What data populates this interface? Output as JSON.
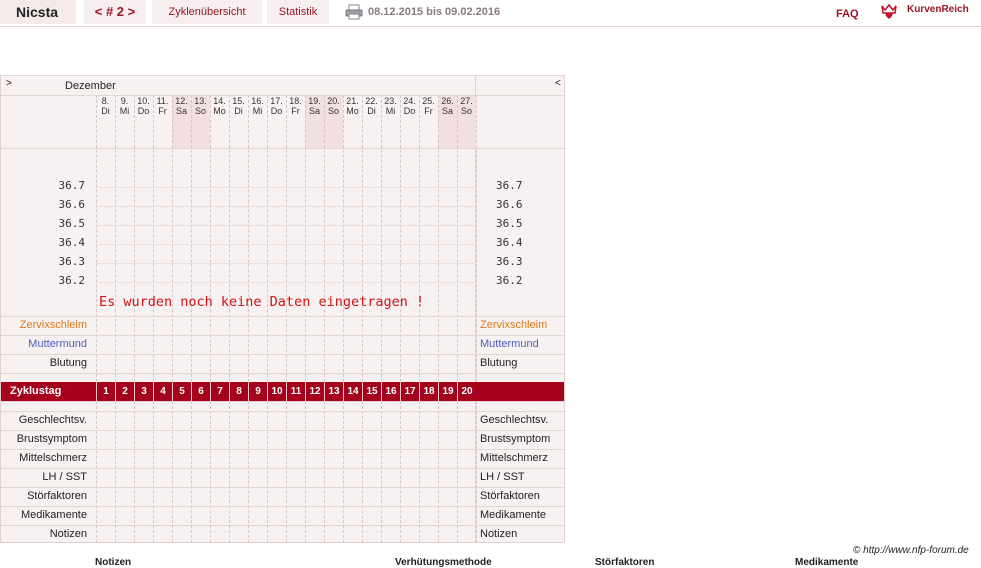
{
  "topbar": {
    "user": "Nicsta",
    "nav": "< # 2 >",
    "zyklen": "Zyklenübersicht",
    "statistik": "Statistik",
    "print_icon": "printer-icon",
    "range": "08.12.2015 bis 09.02.2016",
    "faq": "FAQ",
    "logo_icon": "crown-heart-icon",
    "brand": "KurvenReich"
  },
  "chart": {
    "prev": ">",
    "next": "<",
    "month": "Dezember",
    "days": [
      {
        "n": "8.",
        "d": "Di"
      },
      {
        "n": "9.",
        "d": "Mi"
      },
      {
        "n": "10.",
        "d": "Do"
      },
      {
        "n": "11.",
        "d": "Fr"
      },
      {
        "n": "12.",
        "d": "Sa"
      },
      {
        "n": "13.",
        "d": "So"
      },
      {
        "n": "14.",
        "d": "Mo"
      },
      {
        "n": "15.",
        "d": "Di"
      },
      {
        "n": "16.",
        "d": "Mi"
      },
      {
        "n": "17.",
        "d": "Do"
      },
      {
        "n": "18.",
        "d": "Fr"
      },
      {
        "n": "19.",
        "d": "Sa"
      },
      {
        "n": "20.",
        "d": "So"
      },
      {
        "n": "21.",
        "d": "Mo"
      },
      {
        "n": "22.",
        "d": "Di"
      },
      {
        "n": "23.",
        "d": "Mi"
      },
      {
        "n": "24.",
        "d": "Do"
      },
      {
        "n": "25.",
        "d": "Fr"
      },
      {
        "n": "26.",
        "d": "Sa"
      },
      {
        "n": "27.",
        "d": "So"
      }
    ],
    "temps": [
      "36.7",
      "36.6",
      "36.5",
      "36.4",
      "36.3",
      "36.2"
    ],
    "message": "Es wurden noch keine Daten eingetragen !",
    "rows_top": [
      {
        "label": "Zervixschleim",
        "color": "#e07818"
      },
      {
        "label": "Muttermund",
        "color": "#4a5fc4"
      },
      {
        "label": "Blutung",
        "color": "#222222"
      }
    ],
    "zyklustag_label": "Zyklustag",
    "zyklustage": [
      "1",
      "2",
      "3",
      "4",
      "5",
      "6",
      "7",
      "8",
      "9",
      "10",
      "11",
      "12",
      "13",
      "14",
      "15",
      "16",
      "17",
      "18",
      "19",
      "20"
    ],
    "rows_bottom": [
      "Geschlechtsv.",
      "Brustsymptom",
      "Mittelschmerz",
      "LH / SST",
      "Störfaktoren",
      "Medikamente",
      "Notizen"
    ]
  },
  "footer": {
    "copyright": "© http://www.nfp-forum.de",
    "cols": [
      "Notizen",
      "Verhütungsmethode",
      "Störfaktoren",
      "Medikamente"
    ]
  }
}
